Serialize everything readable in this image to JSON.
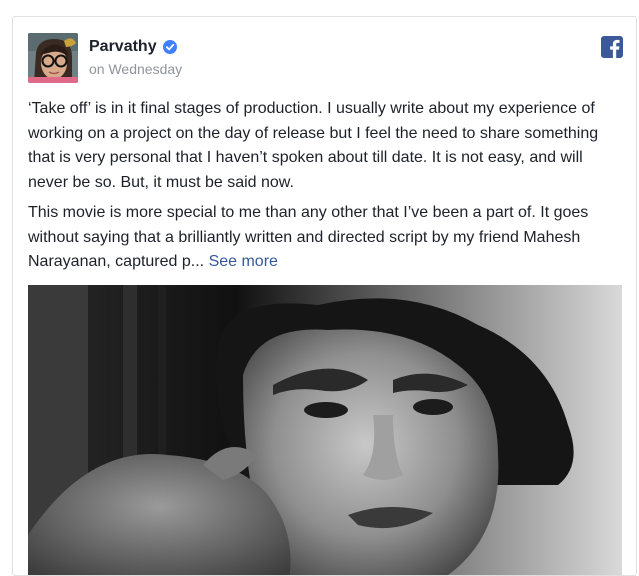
{
  "post": {
    "author": "Parvathy",
    "timestamp": "on Wednesday",
    "paragraph1": "‘Take off’ is in it final stages of production. I usually write about my experience of working on a project on the day of release but I feel the need to share something that is very personal that I haven’t spoken about till date. It is not easy, and will never be so. But, it must be said now.",
    "paragraph2": "This movie is more special to me than any other that I’ve been a part of. It goes without saying that a brilliantly written and directed script by my friend Mahesh Narayanan, captured p...",
    "see_more": "See more"
  },
  "icons": {
    "verified": "verified-badge-icon",
    "platform": "facebook-icon"
  },
  "colors": {
    "text": "#1d2129",
    "secondary": "#90949c",
    "link": "#365899",
    "brand": "#3b5998",
    "verified": "#4080ff"
  }
}
